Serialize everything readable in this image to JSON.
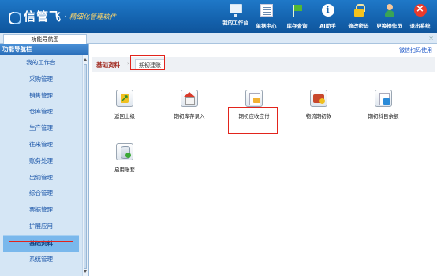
{
  "header": {
    "brand": "信管飞",
    "brand_dot": "·",
    "slogan": "精细化管理软件",
    "nav": [
      {
        "label": "我的工作台",
        "icon": "monitor-icon"
      },
      {
        "label": "单据中心",
        "icon": "document-list-icon"
      },
      {
        "label": "库存查询",
        "icon": "flag-icon"
      },
      {
        "label": "AI助手",
        "icon": "info-icon"
      },
      {
        "label": "修改密码",
        "icon": "lock-icon"
      },
      {
        "label": "更换操作员",
        "icon": "user-icon"
      },
      {
        "label": "退出系统",
        "icon": "exit-icon"
      }
    ]
  },
  "tabs": {
    "active_tab": "功能导航图",
    "close_symbol": "×"
  },
  "sidebar": {
    "title": "功能导航栏",
    "items": [
      {
        "label": "我的工作台"
      },
      {
        "label": "采购管理"
      },
      {
        "label": "销售管理"
      },
      {
        "label": "仓库管理"
      },
      {
        "label": "生产管理"
      },
      {
        "label": "往来管理"
      },
      {
        "label": "账务处理"
      },
      {
        "label": "出纳管理"
      },
      {
        "label": "综合管理"
      },
      {
        "label": "票据管理"
      },
      {
        "label": "扩展应用"
      },
      {
        "label": "基础资料",
        "active": true
      },
      {
        "label": "系统管理"
      }
    ]
  },
  "main": {
    "helper_link": "微信扫码使用",
    "breadcrumb": {
      "root": "基础资料",
      "separator": "›",
      "current": "期初建账"
    },
    "tiles": [
      {
        "label": "返回上级",
        "icon": "up-arrow-icon"
      },
      {
        "label": "期初库存录入",
        "icon": "house-icon"
      },
      {
        "label": "期初应收应付",
        "icon": "receivable-payable-icon"
      },
      {
        "label": "物流期初款",
        "icon": "logistics-box-icon"
      },
      {
        "label": "期初科目余额",
        "icon": "account-sheet-icon"
      },
      {
        "label": "启用账套",
        "icon": "database-enable-icon"
      }
    ]
  },
  "colors": {
    "header_blue": "#1462ad",
    "sidebar_bg": "#d5e6f5",
    "highlight_red": "#e2241c",
    "breadcrumb_red": "#a0281e",
    "link_blue": "#1a55c8"
  }
}
